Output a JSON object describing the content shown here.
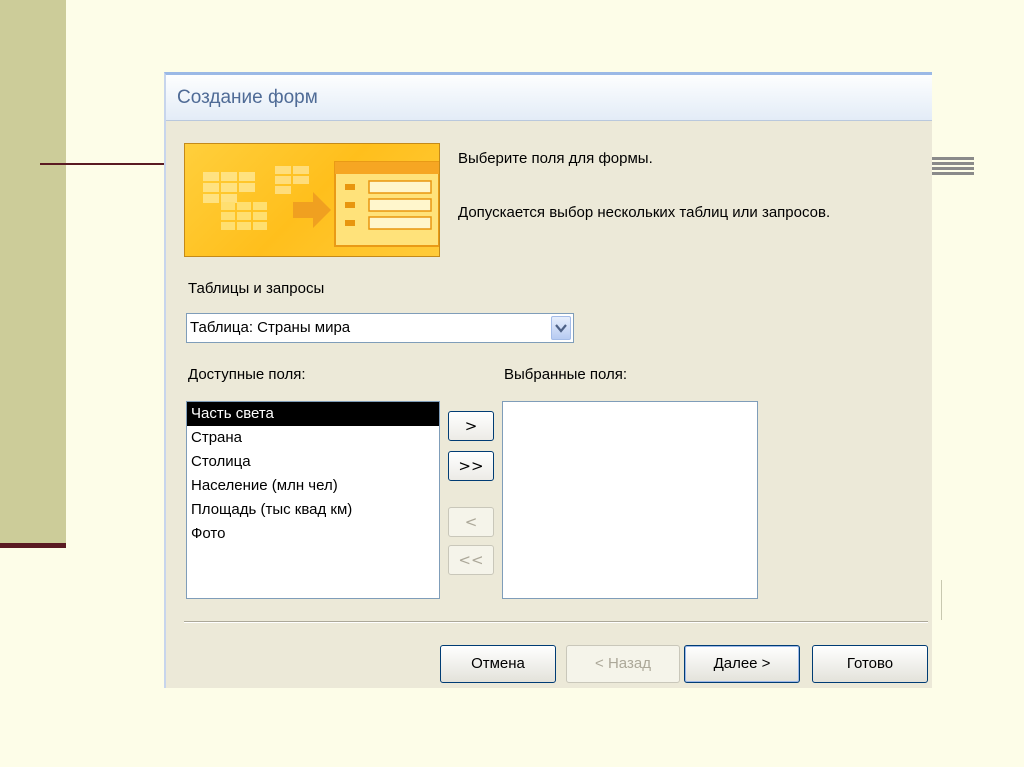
{
  "dialog": {
    "title": "Создание форм",
    "instruction_1": "Выберите поля для формы.",
    "instruction_2": "Допускается выбор нескольких таблиц или запросов."
  },
  "tables": {
    "label": "Таблицы и запросы",
    "selected": "Таблица: Страны мира"
  },
  "available": {
    "label": "Доступные поля:",
    "items": [
      "Часть света",
      "Страна",
      "Столица",
      "Население (млн чел)",
      "Площадь (тыс квад км)",
      "Фото"
    ]
  },
  "selected_fields": {
    "label": "Выбранные поля:",
    "items": []
  },
  "move_buttons": {
    "add_one": ">",
    "add_all": ">>",
    "remove_one": "<",
    "remove_all": "<<"
  },
  "buttons": {
    "cancel": "Отмена",
    "back": "< Назад",
    "next": "Далее >",
    "finish": "Готово"
  },
  "colors": {
    "title_text": "#4f6b96",
    "dialog_bg": "#ece9d8",
    "selection_bg": "#000000",
    "wizard_art": "#ffc125"
  }
}
